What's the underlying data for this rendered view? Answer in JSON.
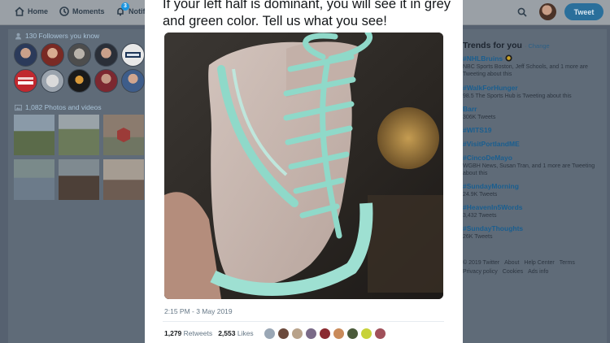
{
  "nav": {
    "home": "Home",
    "moments": "Moments",
    "notifications": "Notif",
    "notification_count": "3",
    "tweet_button": "Tweet"
  },
  "left": {
    "followers_heading": "130 Followers you know",
    "photos_heading": "1,082 Photos and videos"
  },
  "tweet": {
    "text": "If your left half is dominant, you will see it in grey and green color. Tell us what you see!",
    "timestamp": "2:15 PM - 3 May 2019",
    "retweets_count": "1,279",
    "retweets_label": "Retweets",
    "likes_count": "2,553",
    "likes_label": "Likes"
  },
  "trends": {
    "title": "Trends for you",
    "change": "· Change",
    "items": [
      {
        "name": "#NHLBruins",
        "desc": "NBC Sports Boston, Jeff Schools, and 1 more are Tweeting about this"
      },
      {
        "name": "#WalkForHunger",
        "desc": "98.5 The Sports Hub is Tweeting about this"
      },
      {
        "name": "Barr",
        "desc": "306K Tweets"
      },
      {
        "name": "#WITS19",
        "desc": ""
      },
      {
        "name": "#VisitPortlandME",
        "desc": ""
      },
      {
        "name": "#CincoDeMayo",
        "desc": "WGBH News, Susan Tran, and 1 more are Tweeting about this"
      },
      {
        "name": "#SundayMorning",
        "desc": "24.9K Tweets"
      },
      {
        "name": "#HeavenIn5Words",
        "desc": "3,432 Tweets"
      },
      {
        "name": "#SundayThoughts",
        "desc": "26K Tweets"
      }
    ]
  },
  "footer": {
    "links": [
      "© 2019 Twitter",
      "About",
      "Help Center",
      "Terms",
      "Privacy policy",
      "Cookies",
      "Ads info"
    ]
  },
  "colors": {
    "accent": "#1da1f2",
    "overlay": "#566170",
    "shoe_canvas": "#c9b7b0",
    "shoe_laces": "#8fd9c9"
  }
}
